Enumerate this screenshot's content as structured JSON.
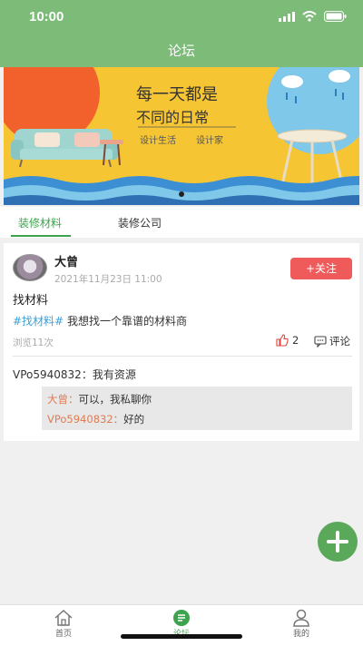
{
  "status": {
    "time": "10:00"
  },
  "nav": {
    "title": "论坛"
  },
  "banner": {
    "headline1": "每一天都是",
    "headline2": "不同的日常",
    "sub1": "设计生活",
    "sub2": "设计家"
  },
  "tabs": [
    {
      "label": "装修材料",
      "active": true
    },
    {
      "label": "装修公司",
      "active": false
    }
  ],
  "post": {
    "user": "大曾",
    "date": "2021年11月23日  11:00",
    "follow_label": "+关注",
    "title": "找材料",
    "tag": "#找材料#",
    "content": "我想找一个靠谱的材料商",
    "views": "浏览11次",
    "likes": "2",
    "comment_label": "评论",
    "comment": {
      "user": "VPo5940832",
      "text": "我有资源"
    },
    "replies": [
      {
        "user": "大曾",
        "text": "可以，我私聊你"
      },
      {
        "user": "VPo5940832",
        "text": "好的"
      }
    ]
  },
  "bottom_nav": [
    {
      "label": "首页",
      "icon": "home-icon"
    },
    {
      "label": "论坛",
      "icon": "forum-icon",
      "active": true
    },
    {
      "label": "我的",
      "icon": "profile-icon"
    }
  ],
  "colors": {
    "primary": "#7dbb78",
    "accent_green": "#3da34e",
    "follow_red": "#ef5a5a",
    "tag_blue": "#3aa0d9",
    "reply_name": "#e07b52"
  }
}
